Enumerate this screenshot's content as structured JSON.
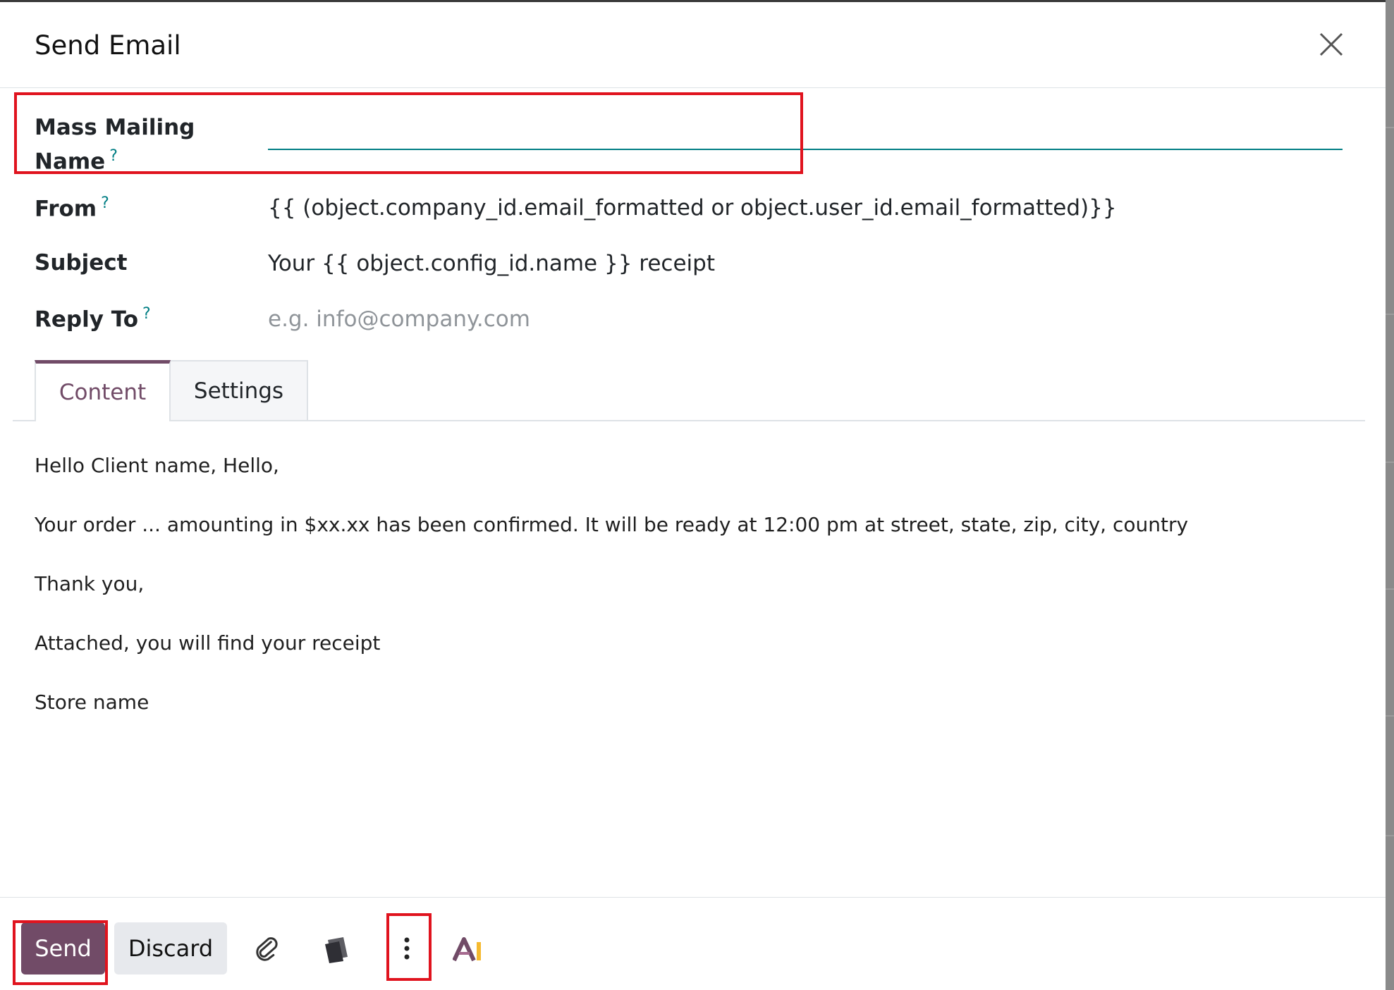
{
  "dialog": {
    "title": "Send Email"
  },
  "fields": {
    "mass_mailing_name": {
      "label_line1": "Mass Mailing",
      "label_line2": "Name",
      "help": "?",
      "value": ""
    },
    "from": {
      "label": "From",
      "help": "?",
      "value": "{{ (object.company_id.email_formatted or object.user_id.email_formatted)}}"
    },
    "subject": {
      "label": "Subject",
      "value": "Your {{ object.config_id.name }} receipt"
    },
    "reply_to": {
      "label": "Reply To",
      "help": "?",
      "placeholder": "e.g. info@company.com"
    }
  },
  "tabs": [
    {
      "label": "Content",
      "active": true
    },
    {
      "label": "Settings",
      "active": false
    }
  ],
  "body": {
    "lines": [
      "Hello Client name, Hello,",
      "Your order ... amounting in $xx.xx has been confirmed. It will be ready at 12:00 pm at street, state, zip, city, country",
      "Thank you,",
      "Attached, you will find your receipt",
      "Store name"
    ]
  },
  "footer": {
    "send_label": "Send",
    "discard_label": "Discard",
    "icons": [
      "paperclip-icon",
      "template-icon",
      "more-options-icon",
      "ai-icon"
    ]
  },
  "colors": {
    "primary": "#714b67",
    "accent_teal": "#017e84",
    "highlight_red": "#e0131e",
    "ai_orange": "#f5b92f"
  }
}
